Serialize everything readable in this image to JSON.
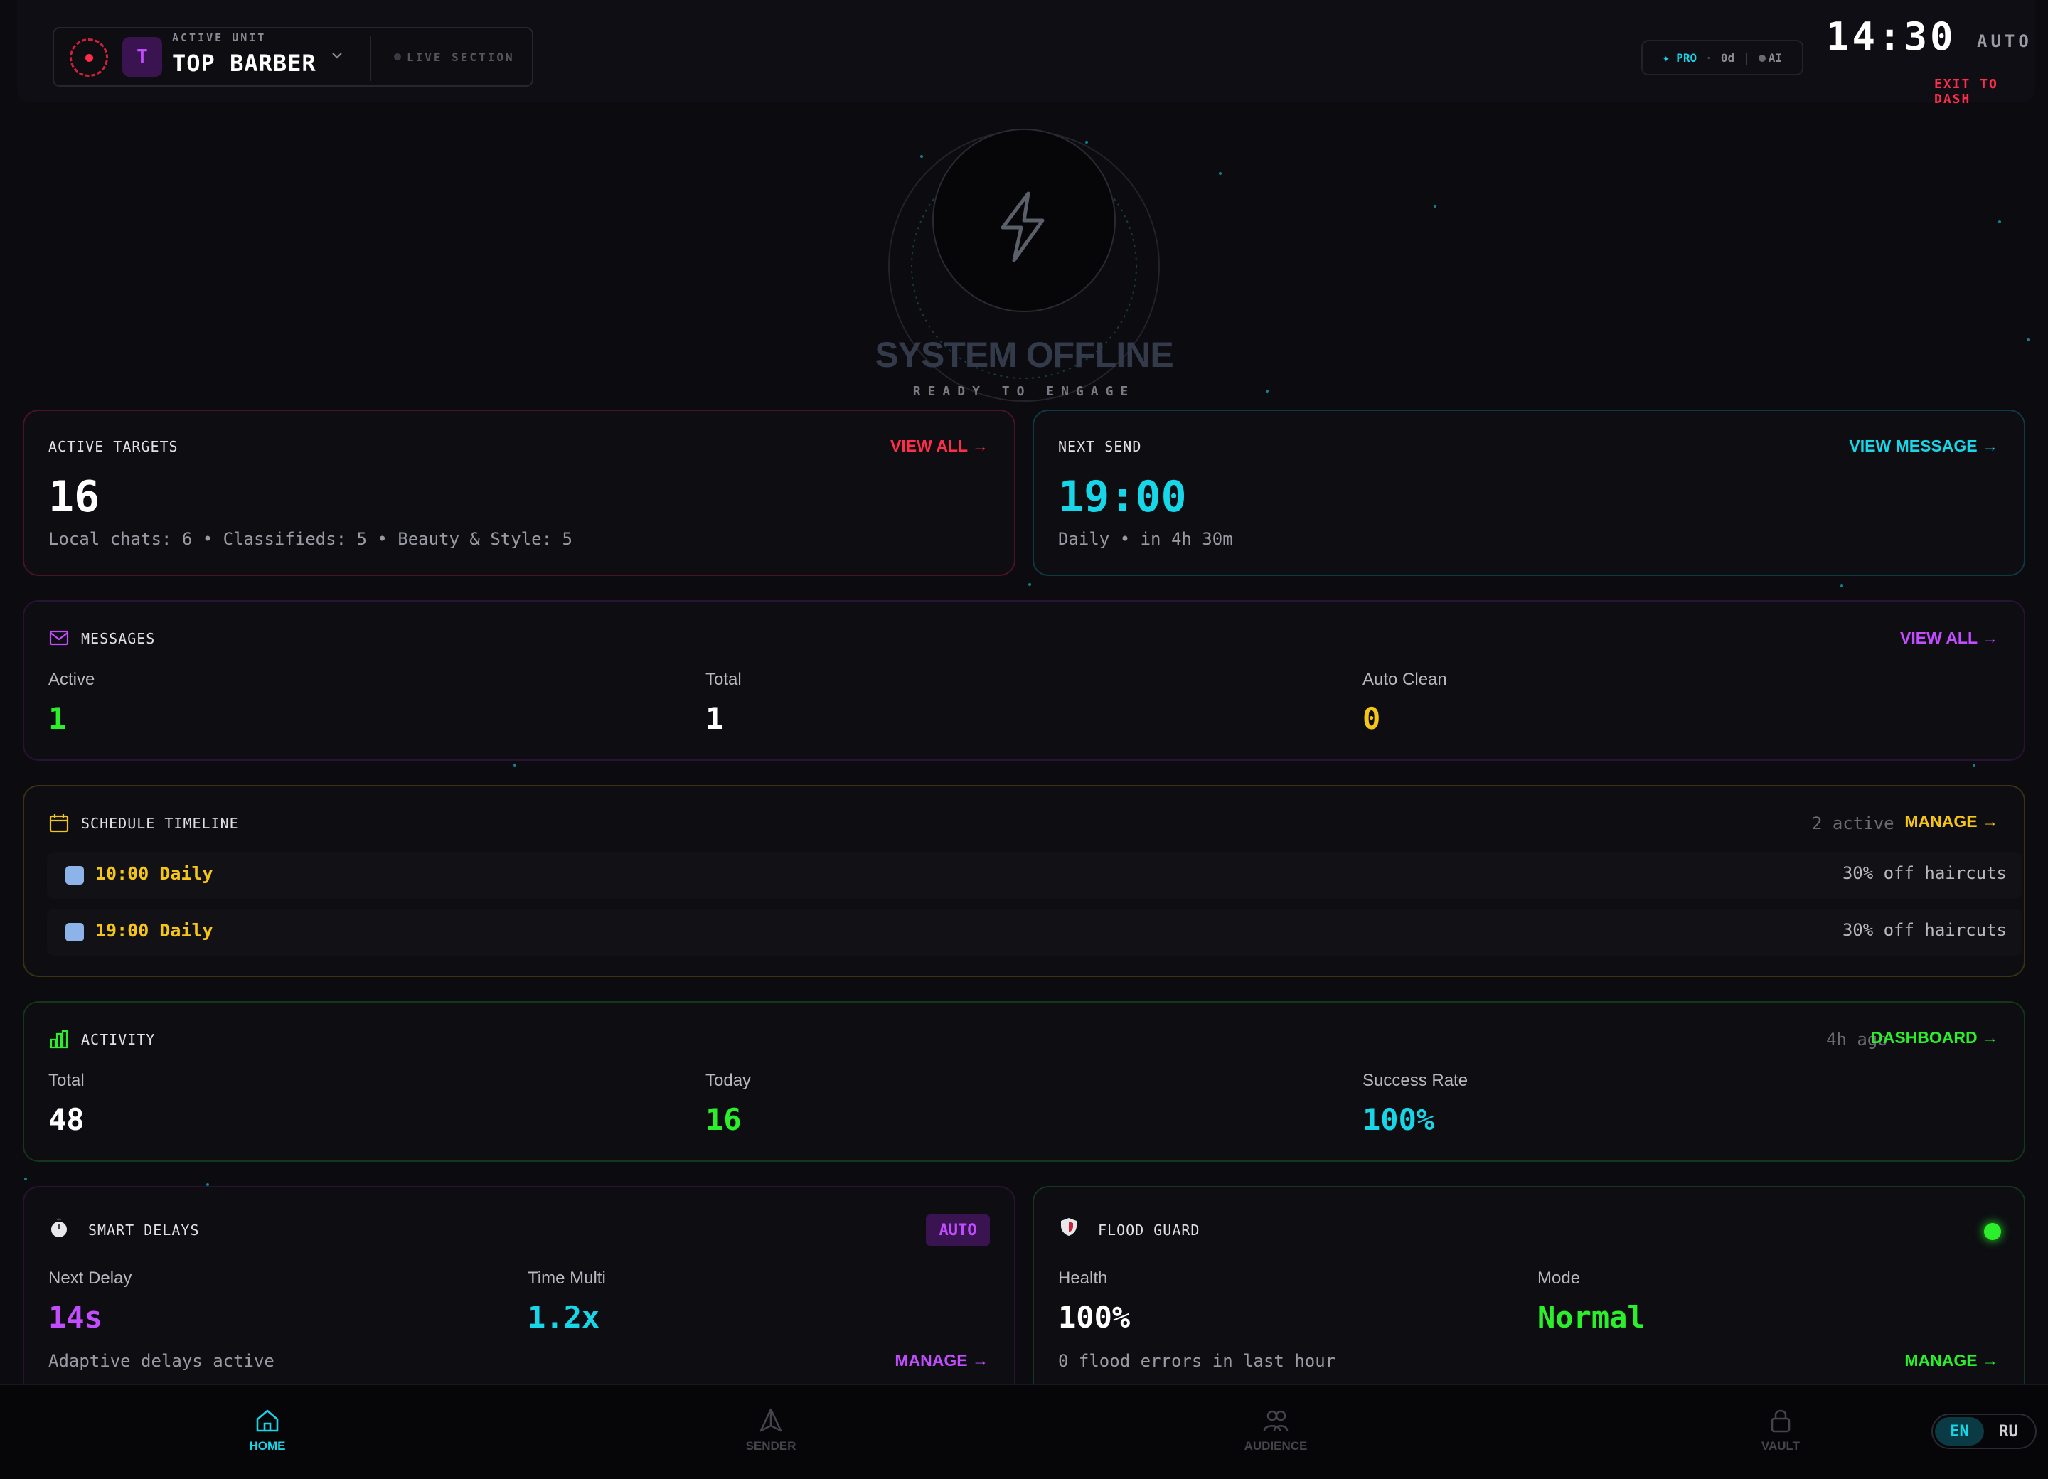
{
  "header": {
    "unit_caption": "ACTIVE UNIT",
    "avatar_letter": "T",
    "unit_name": "TOP BARBER",
    "live_label": "LIVE SECTION",
    "plan_label": "PRO",
    "days_label": "0d",
    "ai_label": "AI",
    "clock": "14:30",
    "mode": "AUTO",
    "exit_label": "EXIT TO DASH"
  },
  "hero": {
    "title": "SYSTEM OFFLINE",
    "subtitle": "READY TO ENGAGE"
  },
  "targets": {
    "caption": "ACTIVE TARGETS",
    "link": "VIEW ALL →",
    "count": "16",
    "breakdown": "Local chats: 6 • Classifieds: 5 • Beauty & Style: 5"
  },
  "next_send": {
    "caption": "NEXT SEND",
    "link": "VIEW MESSAGE →",
    "time": "19:00",
    "detail": "Daily • in 4h 30m"
  },
  "messages": {
    "caption": "MESSAGES",
    "link": "VIEW ALL →",
    "stats": [
      {
        "label": "Active",
        "value": "1"
      },
      {
        "label": "Total",
        "value": "1"
      },
      {
        "label": "Auto Clean",
        "value": "0"
      }
    ]
  },
  "schedule": {
    "caption": "SCHEDULE TIMELINE",
    "count": "2 active",
    "link": "MANAGE →",
    "rows": [
      {
        "time": "10:00 Daily",
        "text": "30% off haircuts"
      },
      {
        "time": "19:00 Daily",
        "text": "30% off haircuts"
      }
    ]
  },
  "activity": {
    "caption": "ACTIVITY",
    "ago": "4h ago",
    "link": "DASHBOARD →",
    "stats": [
      {
        "label": "Total",
        "value": "48"
      },
      {
        "label": "Today",
        "value": "16"
      },
      {
        "label": "Success Rate",
        "value": "100%"
      }
    ]
  },
  "delays": {
    "caption": "SMART DELAYS",
    "badge": "AUTO",
    "next_label": "Next Delay",
    "next_value": "14s",
    "multi_label": "Time Multi",
    "multi_value": "1.2x",
    "note": "Adaptive delays active",
    "link": "MANAGE →"
  },
  "flood": {
    "caption": "FLOOD GUARD",
    "health_label": "Health",
    "health_value": "100%",
    "mode_label": "Mode",
    "mode_value": "Normal",
    "note": "0 flood errors in last hour",
    "link": "MANAGE →"
  },
  "nav": {
    "items": [
      {
        "label": "HOME",
        "icon": "home-icon"
      },
      {
        "label": "SENDER",
        "icon": "send-icon"
      },
      {
        "label": "AUDIENCE",
        "icon": "users-icon"
      },
      {
        "label": "VAULT",
        "icon": "lock-icon"
      }
    ],
    "lang": [
      "EN",
      "RU"
    ]
  },
  "colors": {
    "accent_cyan": "#17d6e8",
    "accent_red": "#ff2d4a",
    "accent_purple": "#c24dff",
    "accent_yellow": "#f5c518",
    "accent_green": "#2bef2b"
  }
}
